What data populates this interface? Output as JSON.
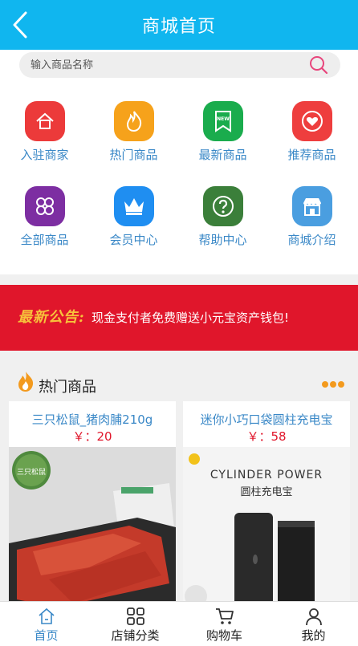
{
  "header": {
    "title": "商城首页"
  },
  "search": {
    "placeholder": "输入商品名称"
  },
  "categories": [
    {
      "label": "入驻商家",
      "icon": "house-icon",
      "color": "#ec3a3a"
    },
    {
      "label": "热门商品",
      "icon": "flame-icon",
      "color": "#f6a21b"
    },
    {
      "label": "最新商品",
      "icon": "new-badge-icon",
      "color": "#1aac4d"
    },
    {
      "label": "推荐商品",
      "icon": "heart-icon",
      "color": "#ee3e3e"
    },
    {
      "label": "全部商品",
      "icon": "grid-flower-icon",
      "color": "#7d2ea2"
    },
    {
      "label": "会员中心",
      "icon": "crown-icon",
      "color": "#1f8ef1"
    },
    {
      "label": "帮助中心",
      "icon": "question-icon",
      "color": "#3b7f3a"
    },
    {
      "label": "商城介绍",
      "icon": "store-icon",
      "color": "#4a9ee0"
    }
  ],
  "notice": {
    "tag": "最新公告:",
    "text": "现金支付者免费赠送小元宝资产钱包!"
  },
  "hot": {
    "title": "热门商品"
  },
  "products": [
    {
      "name": "三只松鼠_猪肉脯210g",
      "price": "￥：20",
      "logo_text": "三只松鼠"
    },
    {
      "name": "迷你小巧口袋圆柱充电宝",
      "price": "￥：58",
      "banner_en": "CYLINDER POWER",
      "banner_cn": "圆柱充电宝"
    }
  ],
  "nav": [
    {
      "label": "首页",
      "icon": "home-icon",
      "active": true
    },
    {
      "label": "店铺分类",
      "icon": "grid-icon",
      "active": false
    },
    {
      "label": "购物车",
      "icon": "cart-icon",
      "active": false
    },
    {
      "label": "我的",
      "icon": "user-icon",
      "active": false
    }
  ],
  "colors": {
    "header": "#10b6ef",
    "notice": "#e0162b",
    "link": "#3a88c7",
    "price": "#e0162b"
  }
}
